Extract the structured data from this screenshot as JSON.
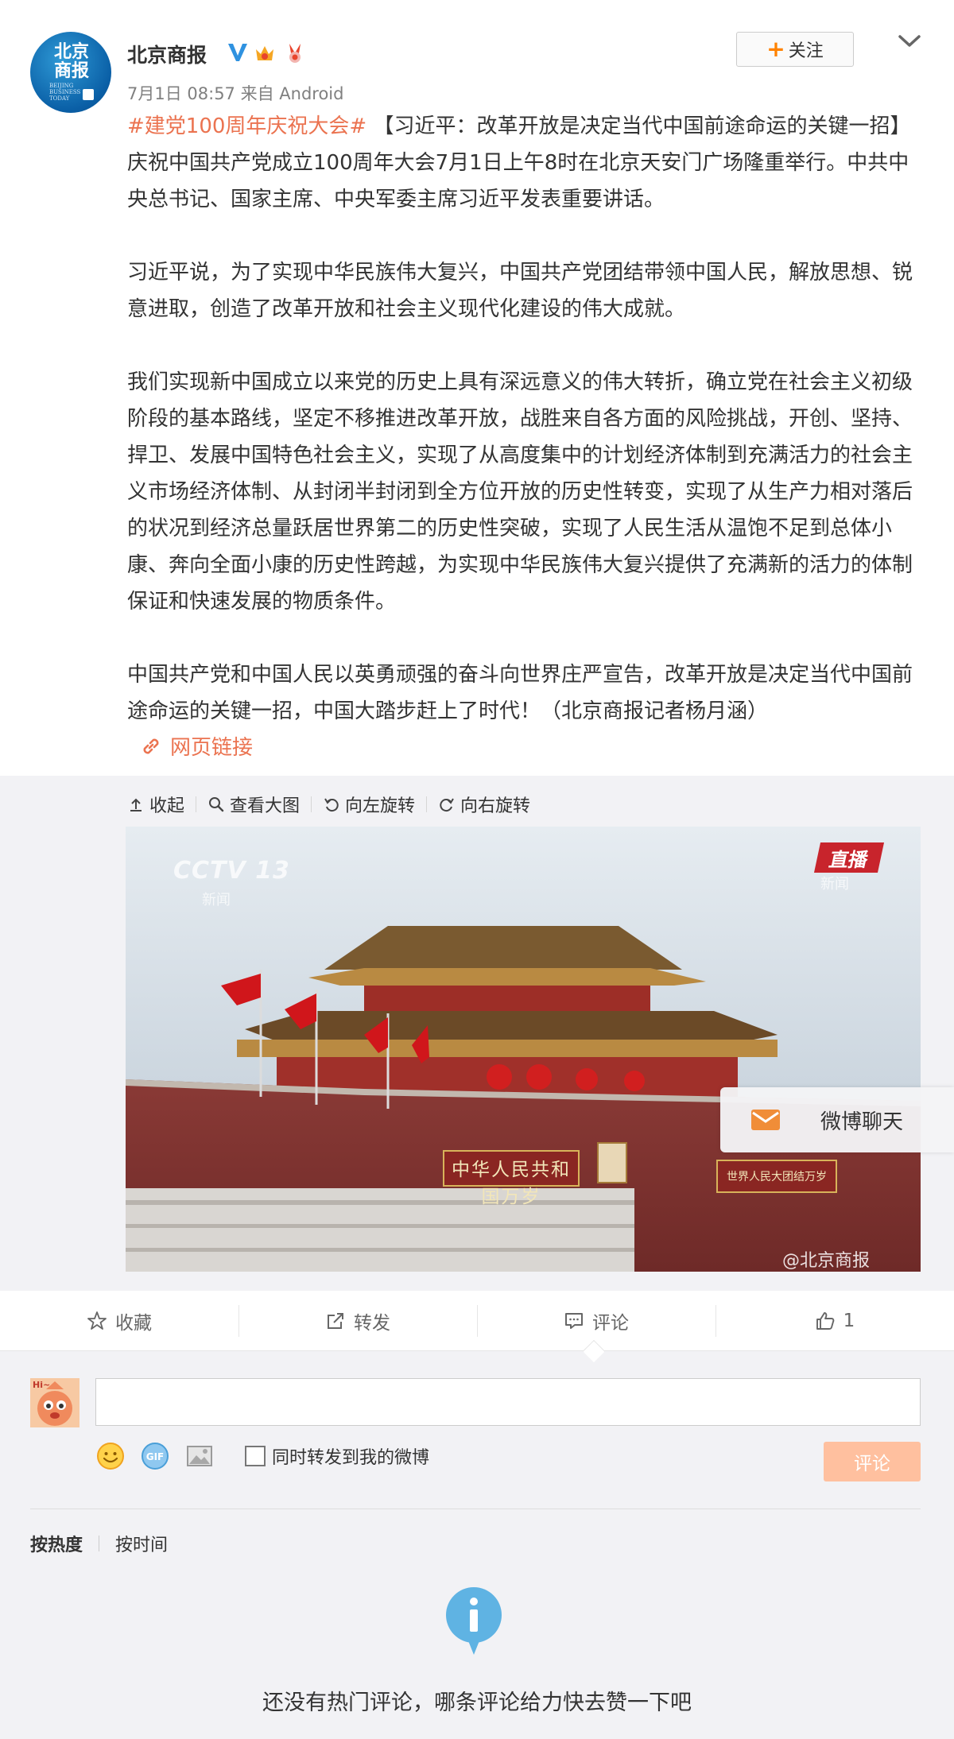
{
  "post": {
    "author": "北京商报",
    "avatar_text_big": "北京商报",
    "avatar_text_small": "BEIJING BUSINESS TODAY",
    "meta": "7月1日 08:57 来自 Android",
    "follow_label": "关注",
    "topic": "#建党100周年庆祝大会#",
    "paragraph1_rest": " 【习近平：改革开放是决定当代中国前途命运的关键一招】庆祝中国共产党成立100周年大会7月1日上午8时在北京天安门广场隆重举行。中共中央总书记、国家主席、中央军委主席习近平发表重要讲话。",
    "paragraph2": "习近平说，为了实现中华民族伟大复兴，中国共产党团结带领中国人民，解放思想、锐意进取，创造了改革开放和社会主义现代化建设的伟大成就。",
    "paragraph3": "我们实现新中国成立以来党的历史上具有深远意义的伟大转折，确立党在社会主义初级阶段的基本路线，坚定不移推进改革开放，战胜来自各方面的风险挑战，开创、坚持、捍卫、发展中国特色社会主义，实现了从高度集中的计划经济体制到充满活力的社会主义市场经济体制、从封闭半封闭到全方位开放的历史性转变，实现了从生产力相对落后的状况到经济总量跃居世界第二的历史性突破，实现了人民生活从温饱不足到总体小康、奔向全面小康的历史性跨越，为实现中华民族伟大复兴提供了充满新的活力的体制保证和快速发展的物质条件。",
    "paragraph4": "中国共产党和中国人民以英勇顽强的奋斗向世界庄严宣告，改革开放是决定当代中国前途命运的关键一招，中国大踏步赶上了时代！（北京商报记者杨月涵）",
    "weblink": "网页链接"
  },
  "media": {
    "tools": [
      "收起",
      "查看大图",
      "向左旋转",
      "向右旋转"
    ],
    "photo_overlay": {
      "channel": "CCTV 13",
      "channel_sub": "新闻",
      "live": "直播",
      "live_sub": "新闻",
      "banner_left": "中华人民共和国万岁",
      "banner_right": "世界人民大团结万岁",
      "watermark": "@北京商报"
    }
  },
  "chat_float": {
    "label": "微博聊天"
  },
  "actions": {
    "favorite": "收藏",
    "repost": "转发",
    "comment": "评论",
    "like_count": "1"
  },
  "composer": {
    "checkbox_label": "同时转发到我的微博",
    "submit_label": "评论",
    "avatar_text": "Hi~"
  },
  "comments": {
    "sort_hot": "按热度",
    "sort_time": "按时间",
    "empty_message": "还没有热门评论，哪条评论给力快去赞一下吧"
  },
  "colors": {
    "accent": "#eb7350",
    "follow_plus": "#ff8200",
    "submit_disabled": "#ffc09f",
    "verified": "#2f92e0",
    "empty_icon": "#5fb3e3"
  }
}
